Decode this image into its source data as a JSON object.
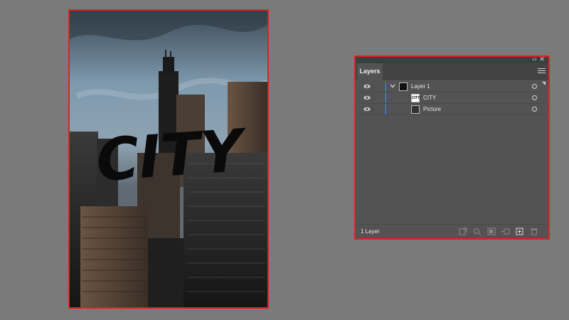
{
  "artboard": {
    "image_alt": "Cityscape photo with CITY lettering",
    "headline": "CITY"
  },
  "panel": {
    "tab_label": "Layers",
    "collapse_label": "‹›",
    "close_label": "✕",
    "layers": [
      {
        "name": "Layer 1",
        "visible": true,
        "color": "#4a6fd8"
      },
      {
        "name": "CITY",
        "visible": true,
        "color": "#4a6fd8",
        "thumb_text": "CITY"
      },
      {
        "name": "Picture",
        "visible": true,
        "color": "#4a6fd8"
      }
    ],
    "layer_count": "1 Layer",
    "bottom_tools": [
      "collect-for-export-icon",
      "locate-object-icon",
      "make-clipping-mask-icon",
      "create-sublayer-icon",
      "new-layer-icon",
      "delete-layer-icon"
    ]
  },
  "colors": {
    "canvas_bg": "#7a7a7a",
    "selection_border": "#e02020",
    "panel_bg": "#535353",
    "layer_color_bar": "#4a6fd8"
  }
}
